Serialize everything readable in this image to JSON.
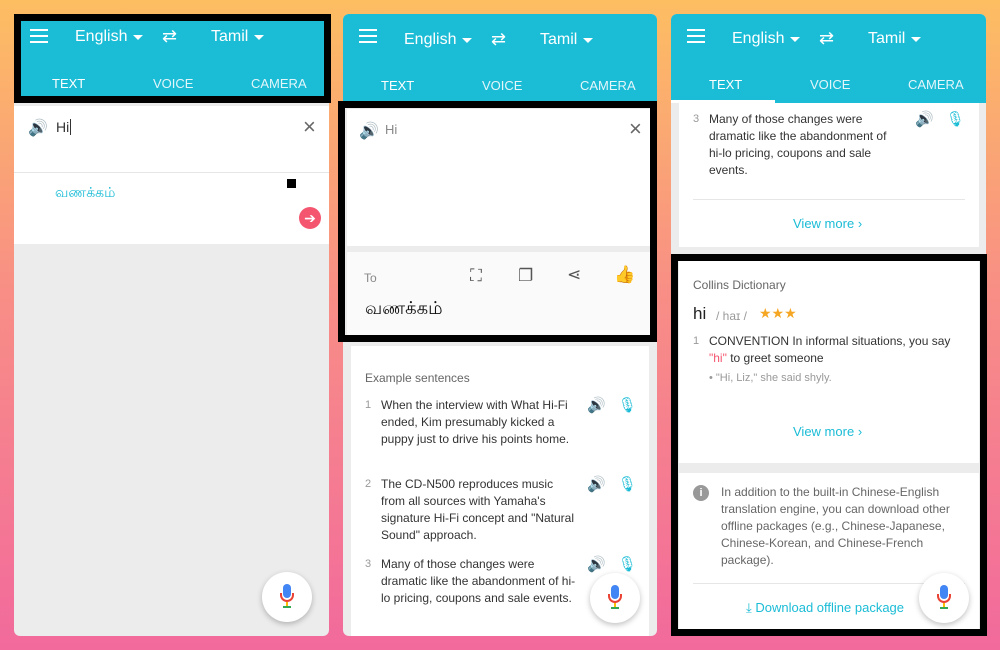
{
  "header": {
    "source_lang": "English",
    "target_lang": "Tamil",
    "swap_icon": "⇄"
  },
  "tabs": [
    "TEXT",
    "VOICE",
    "CAMERA"
  ],
  "panel1": {
    "input_text": "Hi",
    "output_text": "வணக்கம்"
  },
  "panel2": {
    "input_text": "Hi",
    "to_label": "To",
    "output_text": "வணக்கம்",
    "examples_title": "Example sentences",
    "examples": [
      {
        "num": "1",
        "text": "When the interview with What Hi-Fi ended, Kim presumably kicked a puppy just to drive his points home."
      },
      {
        "num": "2",
        "text": "The CD-N500 reproduces music from all sources with Yamaha's signature Hi-Fi concept and \"Natural Sound\" approach."
      },
      {
        "num": "3",
        "text": "Many of those changes were dramatic like the abandonment of hi-lo pricing, coupons and sale events."
      }
    ]
  },
  "panel3": {
    "example3": {
      "num": "3",
      "text": "Many of those changes were dramatic like the abandonment of hi-lo pricing, coupons and sale events."
    },
    "view_more": "View more",
    "dict_title": "Collins Dictionary",
    "word": "hi",
    "pron": "/ haɪ /",
    "stars": "★★★",
    "def_num": "1",
    "def_prefix": "CONVENTION In informal situations, you say ",
    "def_word": "\"hi\"",
    "def_suffix": " to greet someone",
    "example": "• \"Hi, Liz,\" she said shyly.",
    "view_more2": "View more",
    "info_text": "In addition to the built-in Chinese-English translation engine, you can download other offline packages (e.g., Chinese-Japanese, Chinese-Korean, and Chinese-French package).",
    "download_label": "Download offline package"
  },
  "colors": {
    "accent": "#1bbcd6",
    "arrow_button": "#f4566f",
    "star": "#f5a623"
  }
}
